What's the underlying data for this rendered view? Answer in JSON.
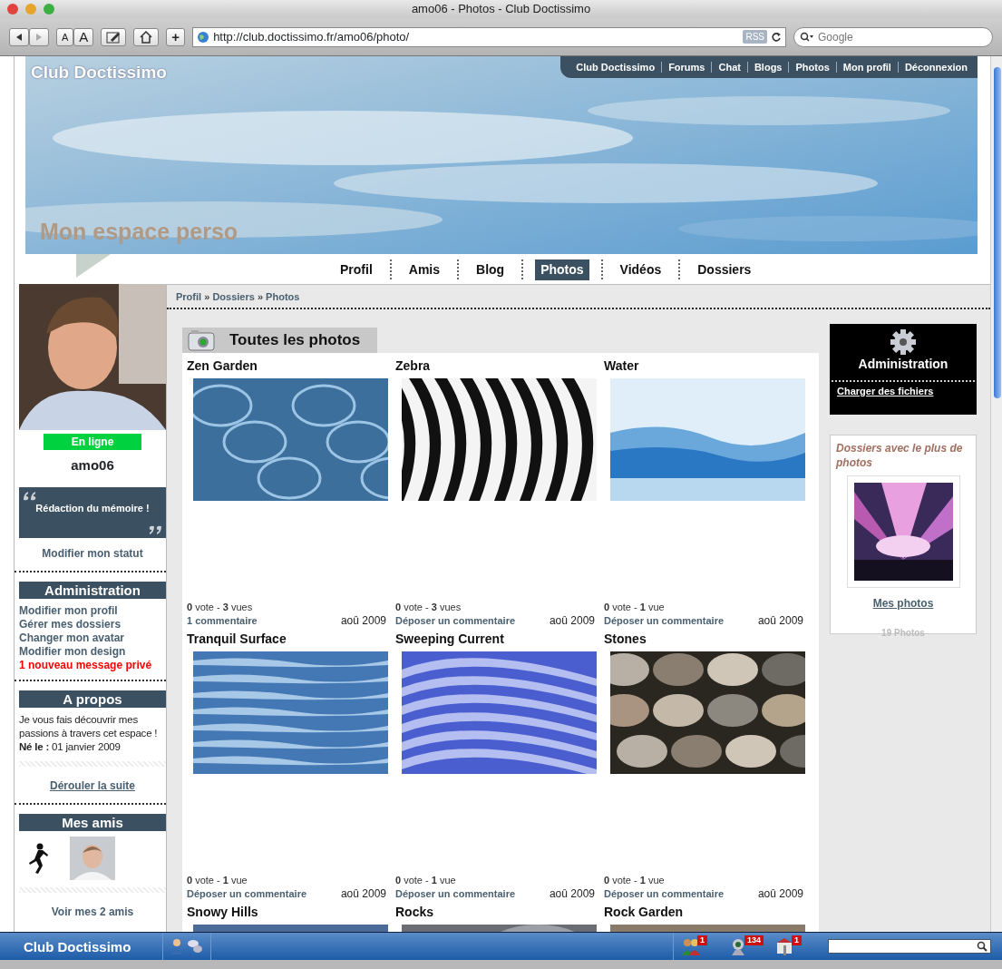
{
  "window": {
    "title": "amo06 - Photos - Club Doctissimo"
  },
  "toolbar": {
    "font_smaller": "A",
    "font_larger": "A",
    "add": "+",
    "url": "http://club.doctissimo.fr/amo06/photo/",
    "rss": "RSS",
    "search_placeholder": "Google"
  },
  "banner": {
    "logo": "Club Doctissimo",
    "heading": "Mon espace perso",
    "links": [
      "Club Doctissimo",
      "Forums",
      "Chat",
      "Blogs",
      "Photos",
      "Mon profil",
      "Déconnexion"
    ]
  },
  "tabs": [
    {
      "label": "Profil",
      "selected": false
    },
    {
      "label": "Amis",
      "selected": false
    },
    {
      "label": "Blog",
      "selected": false
    },
    {
      "label": "Photos",
      "selected": true
    },
    {
      "label": "Vidéos",
      "selected": false
    },
    {
      "label": "Dossiers",
      "selected": false
    }
  ],
  "sidebar": {
    "status": "En ligne",
    "username": "amo06",
    "mood": "Rédaction du mémoire !",
    "mood_link": "Modifier mon statut",
    "admin": {
      "title": "Administration",
      "links": [
        {
          "label": "Modifier mon profil",
          "kind": "link"
        },
        {
          "label": "Gérer mes dossiers",
          "kind": "link"
        },
        {
          "label": "Changer mon avatar",
          "kind": "link"
        },
        {
          "label": "Modifier mon design",
          "kind": "link"
        },
        {
          "label": "1 nouveau message privé",
          "kind": "alert"
        }
      ]
    },
    "about": {
      "title": "A propos",
      "text": "Je vous fais découvrir mes passions à travers cet espace !",
      "born": "**Né le :** 01 janvier 2009",
      "more": "Dérouler la suite"
    },
    "friends": {
      "title": "Mes amis",
      "more": "Voir mes 2 amis"
    }
  },
  "breadcrumb": {
    "items": [
      "Profil",
      "Dossiers",
      "Photos"
    ],
    "separator": "»"
  },
  "gallery": {
    "title": "Toutes les photos",
    "photos": [
      {
        "title": "Zen Garden",
        "stats": "**0** vote - **3** vues",
        "comment": "1 commentaire",
        "date": "aoû 2009"
      },
      {
        "title": "Zebra",
        "stats": "**0** vote - **3** vues",
        "comment": "Déposer un commentaire",
        "date": "aoû 2009"
      },
      {
        "title": "Water",
        "stats": "**0** vote - **1** vue",
        "comment": "Déposer un commentaire",
        "date": "aoû 2009"
      },
      {
        "title": "Tranquil Surface",
        "stats": "**0** vote - **1** vue",
        "comment": "Déposer un commentaire",
        "date": "aoû 2009"
      },
      {
        "title": "Sweeping Current",
        "stats": "**0** vote - **1** vue",
        "comment": "Déposer un commentaire",
        "date": "aoû 2009"
      },
      {
        "title": "Stones",
        "stats": "**0** vote - **1** vue",
        "comment": "Déposer un commentaire",
        "date": "aoû 2009"
      },
      {
        "title": "Snowy Hills"
      },
      {
        "title": "Rocks"
      },
      {
        "title": "Rock Garden"
      }
    ]
  },
  "right": {
    "admin_title": "Administration",
    "admin_link": "Charger des fichiers",
    "folders_title": "Dossiers avec le plus de photos",
    "folder_link": "Mes photos",
    "folder_count": "19 Photos"
  },
  "bottom_bar": {
    "brand": "Club Doctissimo",
    "badges": [
      "1",
      "134",
      "1"
    ]
  }
}
